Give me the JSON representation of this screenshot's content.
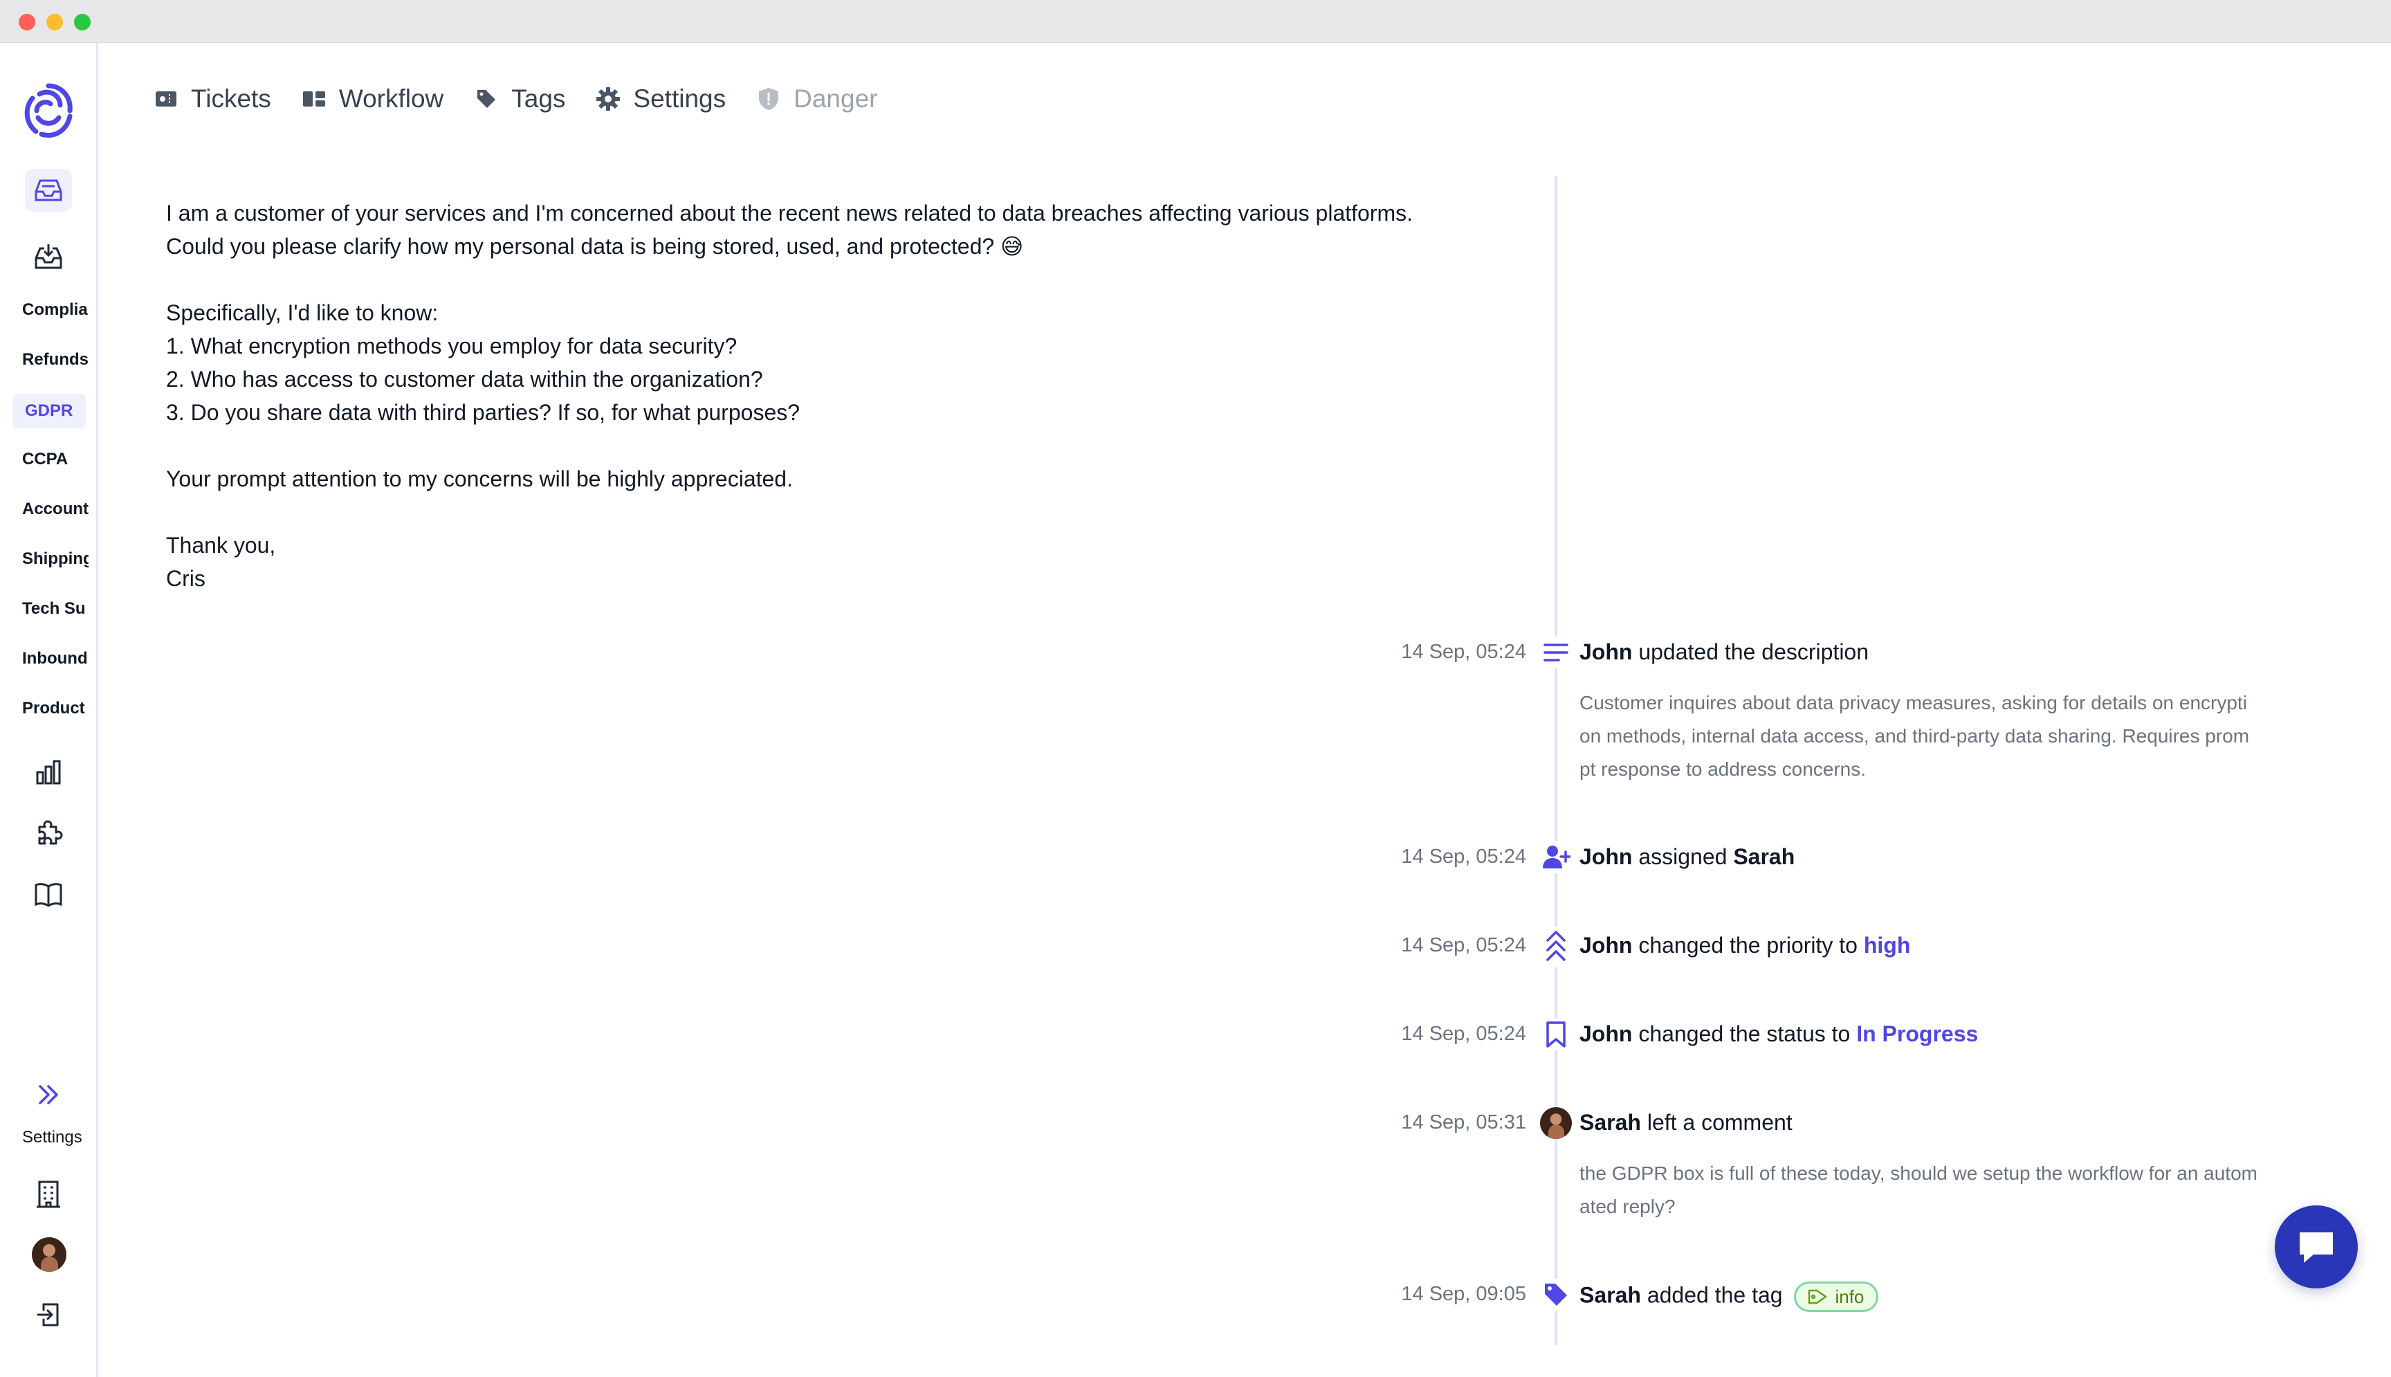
{
  "sidebar": {
    "categories": [
      {
        "label": "Complia"
      },
      {
        "label": "Refunds"
      },
      {
        "label": "GDPR"
      },
      {
        "label": "CCPA"
      },
      {
        "label": "Account"
      },
      {
        "label": "Shipping"
      },
      {
        "label": "Tech Su"
      },
      {
        "label": "Inbound"
      },
      {
        "label": "Product"
      }
    ],
    "active_category": "GDPR",
    "settings_label": "Settings",
    "icons": [
      "inbox-icon",
      "download-inbox-icon",
      "bar-chart-icon",
      "puzzle-icon",
      "book-icon",
      "double-chevron-right-icon",
      "building-icon",
      "logout-icon"
    ]
  },
  "tabs": [
    {
      "label": "Tickets",
      "icon": "ticket-icon"
    },
    {
      "label": "Workflow",
      "icon": "workflow-icon"
    },
    {
      "label": "Tags",
      "icon": "tag-icon"
    },
    {
      "label": "Settings",
      "icon": "gear-icon"
    },
    {
      "label": "Danger",
      "icon": "shield-icon",
      "disabled": true
    }
  ],
  "message": {
    "lines": [
      "I am a customer of your services and I'm concerned about the recent news related to data breaches affecting various platforms.",
      "Could you please clarify how my personal data is being stored, used, and protected? 😅",
      "",
      "Specifically, I'd like to know:",
      "1. What encryption methods you employ for data security?",
      "2. Who has access to customer data within the organization?",
      "3. Do you share data with third parties? If so, for what purposes?",
      "",
      "Your prompt attention to my concerns will be highly appreciated.",
      "",
      "Thank you,",
      "Cris"
    ]
  },
  "timeline": [
    {
      "time": "14 Sep, 05:24",
      "actor": "John",
      "verb": "updated the description",
      "icon": "description-lines-icon",
      "detail": "Customer inquires about data privacy measures, asking for details on encryption methods, internal data access, and third-party data sharing. Requires prompt response to address concerns."
    },
    {
      "time": "14 Sep, 05:24",
      "actor": "John",
      "verb": "assigned",
      "target": "Sarah",
      "icon": "user-plus-icon"
    },
    {
      "time": "14 Sep, 05:24",
      "actor": "John",
      "verb": "changed the priority to",
      "value": "high",
      "icon": "chevrons-up-icon"
    },
    {
      "time": "14 Sep, 05:24",
      "actor": "John",
      "verb": "changed the status to",
      "value": "In Progress",
      "icon": "bookmark-icon"
    },
    {
      "time": "14 Sep, 05:31",
      "actor": "Sarah",
      "verb": "left a comment",
      "icon": "avatar",
      "detail": "the GDPR box is full of these today, should we setup the workflow for an automated reply?"
    },
    {
      "time": "14 Sep, 09:05",
      "actor": "Sarah",
      "verb": "added the tag",
      "tag": "info",
      "icon": "tag-filled-icon"
    }
  ],
  "colors": {
    "accent": "#4f46e5",
    "fab": "#2a35b8",
    "tag_border": "#7fd6a8",
    "tag_bg": "#eefbe3"
  }
}
